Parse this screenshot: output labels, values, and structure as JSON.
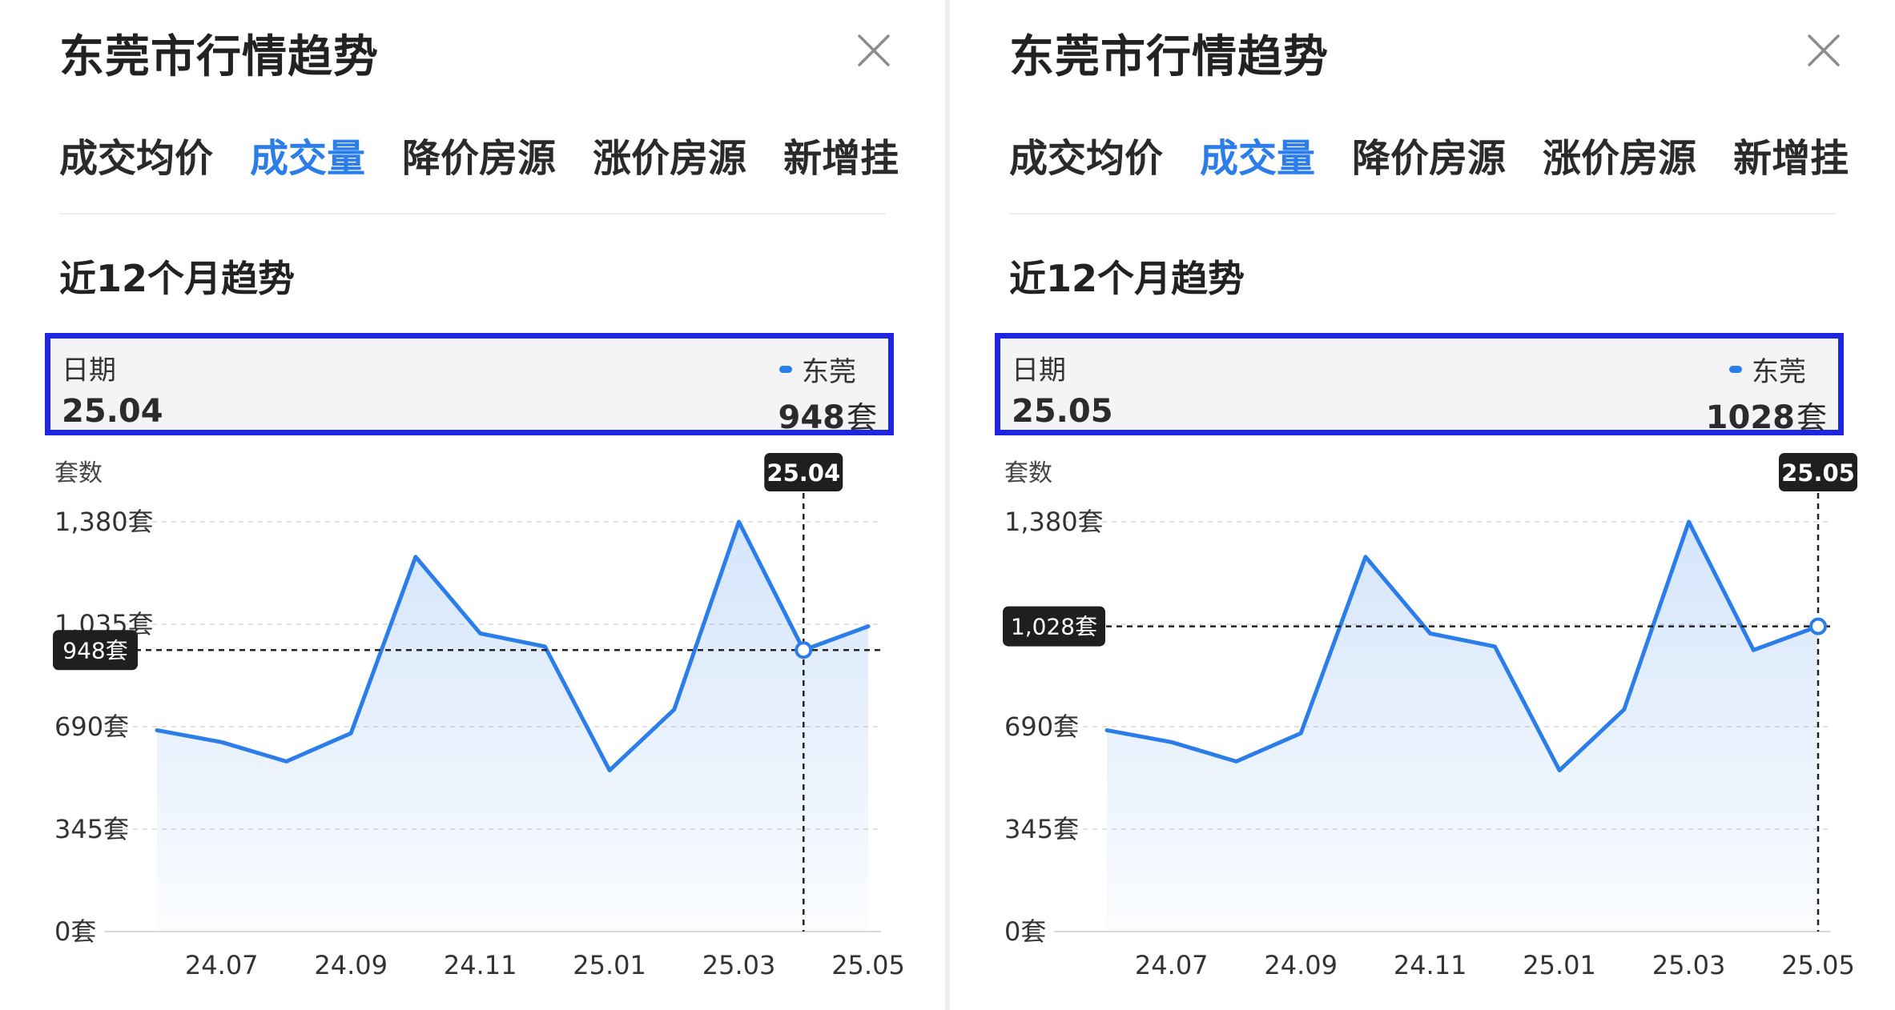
{
  "panels": [
    {
      "title": "东莞市行情趋势",
      "tabs": [
        "成交均价",
        "成交量",
        "降价房源",
        "涨价房源",
        "新增挂"
      ],
      "active_tab": 1,
      "section_title": "近12个月趋势",
      "info": {
        "date_label": "日期",
        "date_value": "25.04",
        "legend_label": "东莞",
        "value": "948",
        "unit": "套"
      },
      "tooltip": {
        "x_label": "25.04",
        "y_label": "948套"
      }
    },
    {
      "title": "东莞市行情趋势",
      "tabs": [
        "成交均价",
        "成交量",
        "降价房源",
        "涨价房源",
        "新增挂"
      ],
      "active_tab": 1,
      "section_title": "近12个月趋势",
      "info": {
        "date_label": "日期",
        "date_value": "25.05",
        "legend_label": "东莞",
        "value": "1028",
        "unit": "套"
      },
      "tooltip": {
        "x_label": "25.05",
        "y_label": "1,028套"
      }
    }
  ],
  "colors": {
    "accent": "#2b7de9",
    "highlight_border": "#1f25e0",
    "tooltip_bg": "#1f1f1f",
    "grid": "#e3e3e3"
  },
  "icons": {
    "close": "close-icon"
  },
  "chart_data": [
    {
      "type": "area",
      "ylabel": "套数",
      "x": [
        "24.06",
        "24.07",
        "24.08",
        "24.09",
        "24.10",
        "24.11",
        "24.12",
        "25.01",
        "25.02",
        "25.03",
        "25.04",
        "25.05"
      ],
      "x_tick_labels": [
        "24.07",
        "24.09",
        "24.11",
        "25.01",
        "25.03",
        "25.05"
      ],
      "series": [
        {
          "name": "东莞",
          "values": [
            678,
            638,
            573,
            668,
            1262,
            1004,
            960,
            543,
            748,
            1380,
            948,
            1028
          ]
        }
      ],
      "y_ticks": [
        0,
        345,
        690,
        1035,
        1380
      ],
      "y_tick_labels": [
        "0套",
        "345套",
        "690套",
        "1,035套",
        "1,380套"
      ],
      "ylim": [
        0,
        1380
      ],
      "grid": true,
      "highlight_index": 10
    },
    {
      "type": "area",
      "ylabel": "套数",
      "x": [
        "24.06",
        "24.07",
        "24.08",
        "24.09",
        "24.10",
        "24.11",
        "24.12",
        "25.01",
        "25.02",
        "25.03",
        "25.04",
        "25.05"
      ],
      "x_tick_labels": [
        "24.07",
        "24.09",
        "24.11",
        "25.01",
        "25.03",
        "25.05"
      ],
      "series": [
        {
          "name": "东莞",
          "values": [
            678,
            638,
            573,
            668,
            1262,
            1004,
            960,
            543,
            748,
            1380,
            948,
            1028
          ]
        }
      ],
      "y_ticks": [
        0,
        345,
        690,
        1035,
        1380
      ],
      "y_tick_labels": [
        "0套",
        "345套",
        "690套",
        "1,035套",
        "1,380套"
      ],
      "ylim": [
        0,
        1380
      ],
      "grid": true,
      "highlight_index": 11
    }
  ]
}
